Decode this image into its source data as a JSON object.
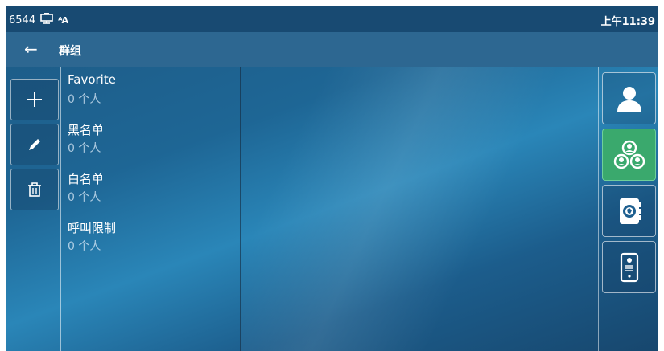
{
  "status": {
    "left_text": "6544",
    "time": "上午11:39",
    "icons": [
      "monitor-icon",
      "font-size-icon"
    ],
    "font_icon_text": "ᴬA"
  },
  "header": {
    "back_icon": "arrow-left-icon",
    "back_glyph": "←",
    "title": "群组"
  },
  "toolbar": {
    "add_icon": "plus-icon",
    "edit_icon": "pencil-icon",
    "delete_icon": "trash-icon"
  },
  "groups": [
    {
      "name": "Favorite",
      "count": "0 个人"
    },
    {
      "name": "黑名单",
      "count": "0 个人"
    },
    {
      "name": "白名单",
      "count": "0 个人"
    },
    {
      "name": "呼叫限制",
      "count": "0 个人"
    }
  ],
  "right_nav": [
    {
      "icon": "contact-icon",
      "active": false
    },
    {
      "icon": "group-icon",
      "active": true
    },
    {
      "icon": "directory-book-icon",
      "active": false
    },
    {
      "icon": "intercom-device-icon",
      "active": false
    }
  ],
  "colors": {
    "accent_active": "#3aa96d",
    "statusbar": "#184a72",
    "titlebar": "#2d6791"
  }
}
